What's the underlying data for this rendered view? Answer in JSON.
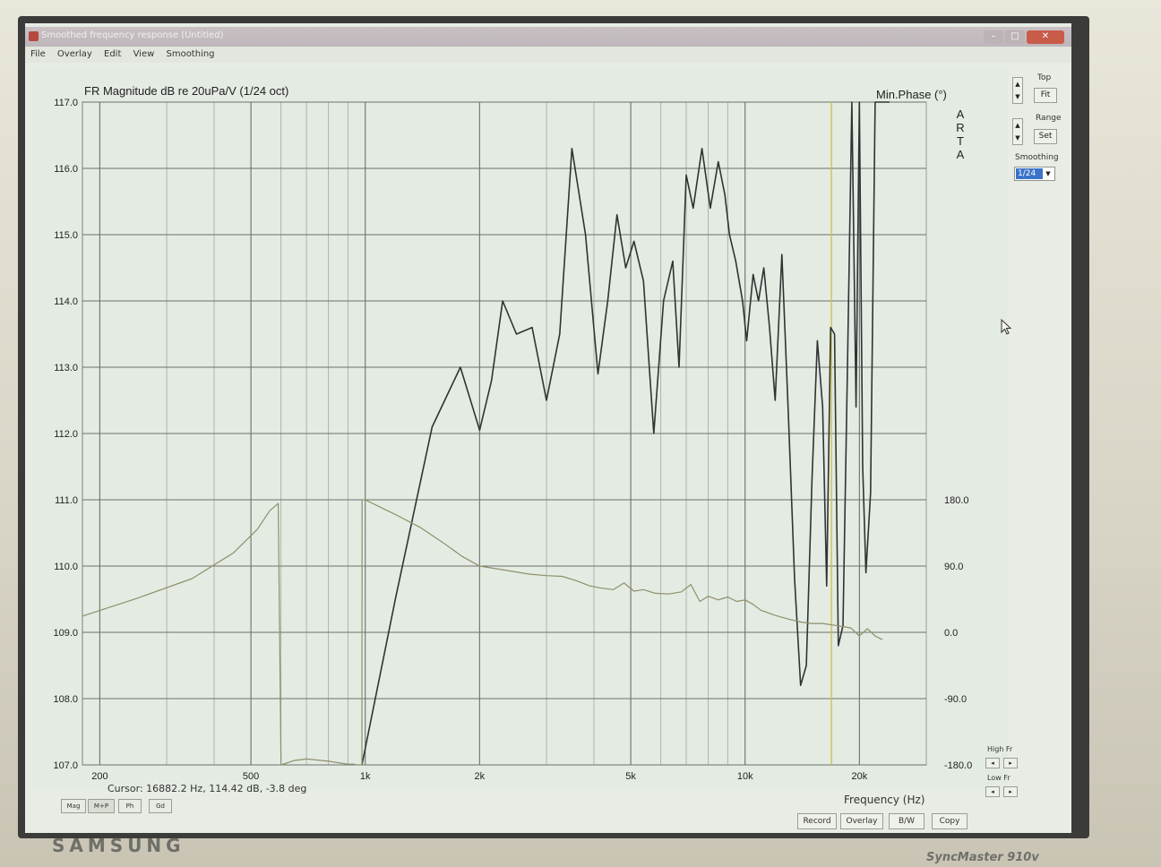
{
  "window": {
    "title": "Smoothed frequency response (Untitled)",
    "controls": {
      "minimize": "–",
      "maximize": "□",
      "close": "✕"
    }
  },
  "menu": [
    "File",
    "Overlay",
    "Edit",
    "View",
    "Smoothing"
  ],
  "side_panel": {
    "top_label": "Top",
    "fit_button": "Fit",
    "range_label": "Range",
    "set_button": "Set",
    "smoothing_label": "Smoothing",
    "smoothing_value": "1/24",
    "high_fr_label": "High Fr",
    "low_fr_label": "Low Fr"
  },
  "status": {
    "cursor": "Cursor: 16882.2 Hz, 114.42 dB, -3.8 deg"
  },
  "tabs": [
    "Mag",
    "M+P",
    "Ph",
    "Gd"
  ],
  "buttons": [
    "Record",
    "Overlay",
    "B/W",
    "Copy"
  ],
  "brand": {
    "name": "SAMSUNG",
    "model": "SyncMaster 910v"
  },
  "chart_data": {
    "type": "line",
    "title": "FR Magnitude dB re 20uPa/V (1/24 oct)",
    "right_title": "Min.Phase (°)",
    "side_text": "ARTA",
    "xlabel": "Frequency (Hz)",
    "x_scale": "log",
    "xlim": [
      180,
      30000
    ],
    "x_ticks": [
      {
        "value": 200,
        "label": "200"
      },
      {
        "value": 500,
        "label": "500"
      },
      {
        "value": 1000,
        "label": "1k"
      },
      {
        "value": 2000,
        "label": "2k"
      },
      {
        "value": 5000,
        "label": "5k"
      },
      {
        "value": 10000,
        "label": "10k"
      },
      {
        "value": 20000,
        "label": "20k"
      }
    ],
    "ylim": [
      107,
      117
    ],
    "y_ticks": [
      "107.0",
      "108.0",
      "109.0",
      "110.0",
      "111.0",
      "112.0",
      "113.0",
      "114.0",
      "115.0",
      "116.0",
      "117.0"
    ],
    "y2lim": [
      -180,
      180
    ],
    "y2_ticks": [
      "-180.0",
      "-90.0",
      "0.0",
      "90.0",
      "180.0"
    ],
    "cursor_x": 16882.2,
    "grid": true,
    "series": [
      {
        "role": "magnitude",
        "color": "#2f3432",
        "axis": "left",
        "x": [
          980,
          1200,
          1500,
          1650,
          1780,
          1870,
          2000,
          2150,
          2300,
          2500,
          2750,
          3000,
          3250,
          3500,
          3800,
          4100,
          4350,
          4600,
          4850,
          5100,
          5400,
          5750,
          6100,
          6450,
          6700,
          7000,
          7300,
          7700,
          8100,
          8500,
          8850,
          9100,
          9450,
          9850,
          10100,
          10500,
          10850,
          11200,
          11600,
          12000,
          12500,
          13000,
          13500,
          14000,
          14500,
          15000,
          15500,
          16000,
          16400,
          16800,
          17200,
          17600,
          18100,
          18600,
          19100,
          19600,
          20000,
          20400,
          20800,
          21400,
          22000,
          23000,
          24000
        ],
        "y": [
          107.0,
          109.5,
          112.1,
          112.6,
          113.0,
          112.6,
          112.05,
          112.8,
          114.0,
          113.5,
          113.6,
          112.5,
          113.5,
          116.3,
          115.0,
          112.9,
          114.0,
          115.3,
          114.5,
          114.9,
          114.3,
          112.0,
          114.0,
          114.6,
          113.0,
          115.9,
          115.4,
          116.3,
          115.4,
          116.1,
          115.6,
          115.0,
          114.6,
          114.0,
          113.4,
          114.4,
          114.0,
          114.5,
          113.6,
          112.5,
          114.7,
          112.3,
          109.8,
          108.2,
          108.5,
          111.3,
          113.4,
          112.4,
          109.7,
          113.6,
          113.5,
          108.8,
          109.1,
          113.0,
          117.0,
          112.4,
          117.0,
          111.5,
          109.9,
          111.1,
          117.0,
          117.0,
          117.0
        ]
      },
      {
        "role": "phase",
        "color": "#8e8f6a",
        "axis": "right",
        "x": [
          180,
          250,
          350,
          450,
          520,
          560,
          590,
          600,
          601,
          650,
          700,
          800,
          900,
          930,
          950,
          980,
          981,
          1000,
          1200,
          1400,
          1600,
          1800,
          2000,
          2300,
          2700,
          3000,
          3300,
          3600,
          3900,
          4200,
          4500,
          4800,
          5100,
          5400,
          5800,
          6300,
          6800,
          7200,
          7600,
          8000,
          8500,
          9000,
          9500,
          10000,
          10500,
          11000,
          12000,
          13000,
          14000,
          15000,
          16000,
          17000,
          18000,
          19000,
          20000,
          21000,
          22000,
          23000
        ],
        "y": [
          22,
          46,
          73,
          108,
          140,
          165,
          175,
          -180,
          -180,
          -174,
          -172,
          -175,
          -179,
          -179,
          -180,
          -180,
          180,
          180,
          160,
          142,
          122,
          103,
          90,
          85,
          79,
          77,
          76,
          70,
          63,
          60,
          58,
          67,
          56,
          58,
          53,
          52,
          55,
          65,
          42,
          49,
          44,
          48,
          42,
          44,
          38,
          30,
          23,
          18,
          14,
          12,
          12,
          10,
          8,
          6,
          -5,
          5,
          -5,
          -10
        ]
      }
    ]
  }
}
